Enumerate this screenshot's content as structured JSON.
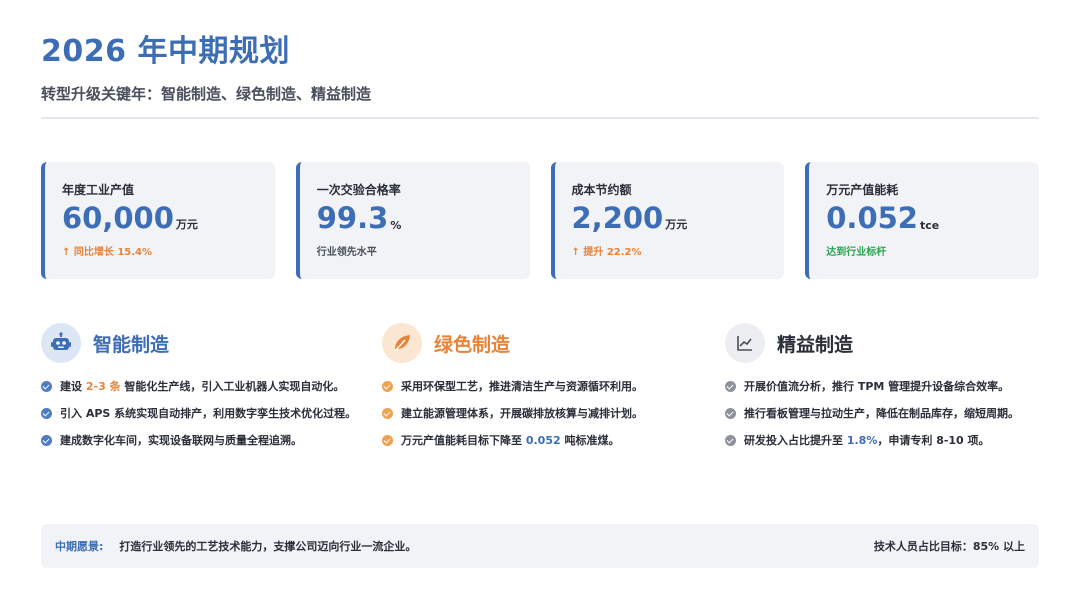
{
  "header": {
    "title": "2026 年中期规划",
    "subtitle": "转型升级关键年：智能制造、绿色制造、精益制造"
  },
  "kpis": [
    {
      "label": "年度工业产值",
      "value": "60,000",
      "unit": "万元",
      "note": "↑ 同比增长 15.4%",
      "note_color": "#e8833a"
    },
    {
      "label": "一次交验合格率",
      "value": "99.3",
      "unit": "%",
      "note": "行业领先水平",
      "note_color": "#4a4f5c"
    },
    {
      "label": "成本节约额",
      "value": "2,200",
      "unit": "万元",
      "note": "↑ 提升 22.2%",
      "note_color": "#e8833a"
    },
    {
      "label": "万元产值能耗",
      "value": "0.052",
      "unit": "tce",
      "note": "达到行业标杆",
      "note_color": "#2aa44f"
    }
  ],
  "columns": {
    "smart": {
      "title": "智能制造",
      "icon": "robot-icon",
      "color": "#3d6db5",
      "items": {
        "i0": {
          "a": "建设 ",
          "b": "2-3 条",
          "c": " 智能化生产线，引入工业机器人实现自动化。"
        },
        "i1": "引入 APS 系统实现自动排产，利用数字孪生技术优化过程。",
        "i2": "建成数字化车间，实现设备联网与质量全程追溯。"
      }
    },
    "green": {
      "title": "绿色制造",
      "icon": "leaf-icon",
      "color": "#e8833a",
      "items": {
        "i0": "采用环保型工艺，推进清洁生产与资源循环利用。",
        "i1": "建立能源管理体系，开展碳排放核算与减排计划。",
        "i2": {
          "a": "万元产值能耗目标下降至 ",
          "b": "0.052",
          "c": " 吨标准煤。"
        }
      }
    },
    "lean": {
      "title": "精益制造",
      "icon": "chart-line-icon",
      "color": "#2b2f3a",
      "items": {
        "i0": "开展价值流分析，推行 TPM 管理提升设备综合效率。",
        "i1": "推行看板管理与拉动生产，降低在制品库存，缩短周期。",
        "i2": {
          "a": "研发投入占比提升至 ",
          "b": "1.8%",
          "c": "，申请专利 8-10 项。"
        }
      }
    }
  },
  "footer": {
    "label": "中期愿景:",
    "text": "打造行业领先的工艺技术能力，支撑公司迈向行业一流企业。",
    "right": "技术人员占比目标：85% 以上"
  }
}
